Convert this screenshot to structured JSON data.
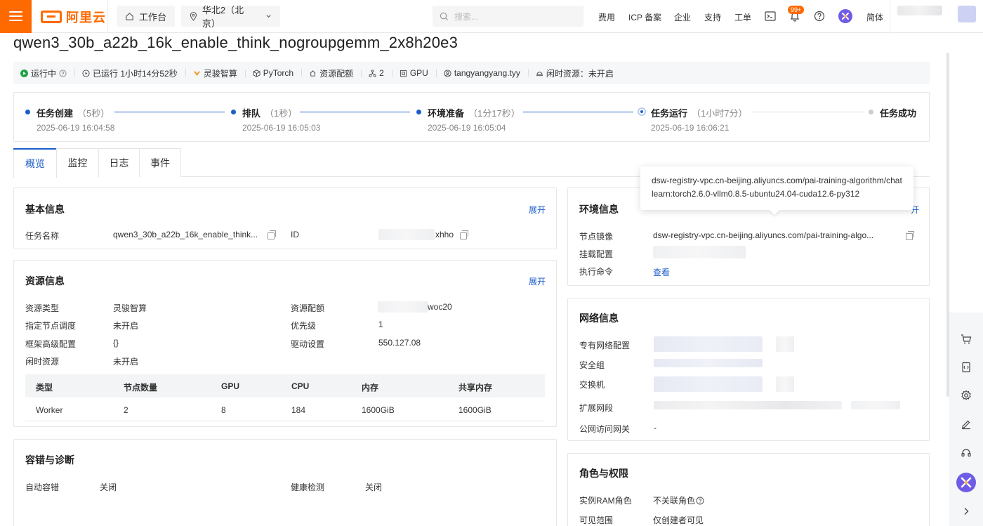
{
  "topbar": {
    "logo_text": "阿里云",
    "workbench": "工作台",
    "region": "华北2（北京）",
    "search_placeholder": "搜索...",
    "links": [
      "费用",
      "ICP 备案",
      "企业",
      "支持",
      "工单"
    ],
    "notification_badge": "99+",
    "language": "简体",
    "accent_color": "#ff6a00"
  },
  "job": {
    "title": "qwen3_30b_a22b_16k_enable_think_nogroupgemm_2x8h20e3",
    "meta": {
      "status": "运行中",
      "running_time": "已运行 1小时14分52秒",
      "resource_type": "灵骏智算",
      "framework": "PyTorch",
      "quota": "资源配额",
      "nodes": "2",
      "gpu": "GPU",
      "user": "tangyangyang.tyy",
      "idle": "闲时资源：未开启"
    }
  },
  "steps": [
    {
      "title": "任务创建",
      "duration": "（5秒）",
      "time": "2025-06-19 16:04:58"
    },
    {
      "title": "排队",
      "duration": "（1秒）",
      "time": "2025-06-19 16:05:03"
    },
    {
      "title": "环境准备",
      "duration": "（1分17秒）",
      "time": "2025-06-19 16:05:04"
    },
    {
      "title": "任务运行",
      "duration": "（1小时7分）",
      "time": "2025-06-19 16:06:21"
    },
    {
      "title": "任务成功",
      "duration": "",
      "time": ""
    }
  ],
  "tabs": [
    "概览",
    "监控",
    "日志",
    "事件"
  ],
  "basic_info": {
    "title": "基本信息",
    "expand": "展开",
    "name_label": "任务名称",
    "name_value": "qwen3_30b_a22b_16k_enable_think...",
    "id_label": "ID",
    "id_suffix": "xhho"
  },
  "resource_info": {
    "title": "资源信息",
    "expand": "展开",
    "left": [
      {
        "label": "资源类型",
        "value": "灵骏智算"
      },
      {
        "label": "指定节点调度",
        "value": "未开启"
      },
      {
        "label": "框架高级配置",
        "value": "{}"
      },
      {
        "label": "闲时资源",
        "value": "未开启"
      }
    ],
    "right": [
      {
        "label": "资源配额",
        "value": "woc20"
      },
      {
        "label": "优先级",
        "value": "1"
      },
      {
        "label": "驱动设置",
        "value": "550.127.08"
      }
    ],
    "table": {
      "headers": [
        "类型",
        "节点数量",
        "GPU",
        "CPU",
        "内存",
        "共享内存"
      ],
      "rows": [
        [
          "Worker",
          "2",
          "8",
          "184",
          "1600GiB",
          "1600GiB"
        ]
      ]
    }
  },
  "fault_tolerance": {
    "title": "容错与诊断",
    "auto_label": "自动容错",
    "auto_value": "关闭",
    "health_label": "健康检测",
    "health_value": "关闭"
  },
  "env_info": {
    "title": "环境信息",
    "expand_tail": "开",
    "image_label": "节点镜像",
    "image_value": "dsw-registry-vpc.cn-beijing.aliyuncs.com/pai-training-algo...",
    "mount_label": "挂载配置",
    "cmd_label": "执行命令",
    "cmd_link": "查看"
  },
  "tooltip": {
    "text": "dsw-registry-vpc.cn-beijing.aliyuncs.com/pai-training-algorithm/chatlearn:torch2.6.0-vllm0.8.5-ubuntu24.04-cuda12.6-py312"
  },
  "network_info": {
    "title": "网络信息",
    "vpc_label": "专有网络配置",
    "sg_label": "安全组",
    "switch_label": "交换机",
    "ext_label": "扩展网段",
    "gateway_label": "公网访问网关",
    "gateway_value": "-"
  },
  "roles": {
    "title": "角色与权限",
    "ram_label": "实例RAM角色",
    "ram_value": "不关联角色",
    "scope_label": "可见范围",
    "scope_value": "仅创建者可见"
  }
}
